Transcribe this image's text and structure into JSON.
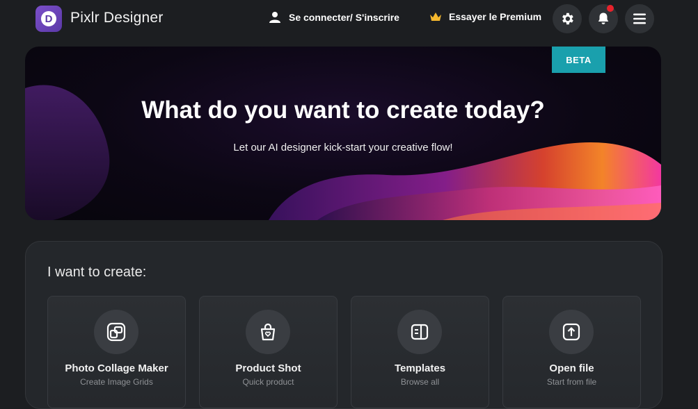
{
  "header": {
    "app_title": "Pixlr Designer",
    "logo_letter": "D",
    "login_label": "Se connecter/ S'inscrire",
    "premium_label": "Essayer le Premium",
    "logo_color": "#6a44b8",
    "crown_color": "#f5b82e",
    "notification_dot_color": "#e8222b"
  },
  "hero": {
    "badge": "BETA",
    "badge_color": "#1aa0ad",
    "title": "What do you want to create today?",
    "subtitle": "Let our AI designer kick-start your creative flow!"
  },
  "create": {
    "title": "I want to create:",
    "cards": [
      {
        "label": "Photo Collage Maker",
        "desc": "Create Image Grids",
        "icon": "collage-icon"
      },
      {
        "label": "Product Shot",
        "desc": "Quick product",
        "icon": "shopping-bag-icon"
      },
      {
        "label": "Templates",
        "desc": "Browse all",
        "icon": "templates-icon"
      },
      {
        "label": "Open file",
        "desc": "Start from file",
        "icon": "upload-icon"
      }
    ]
  }
}
